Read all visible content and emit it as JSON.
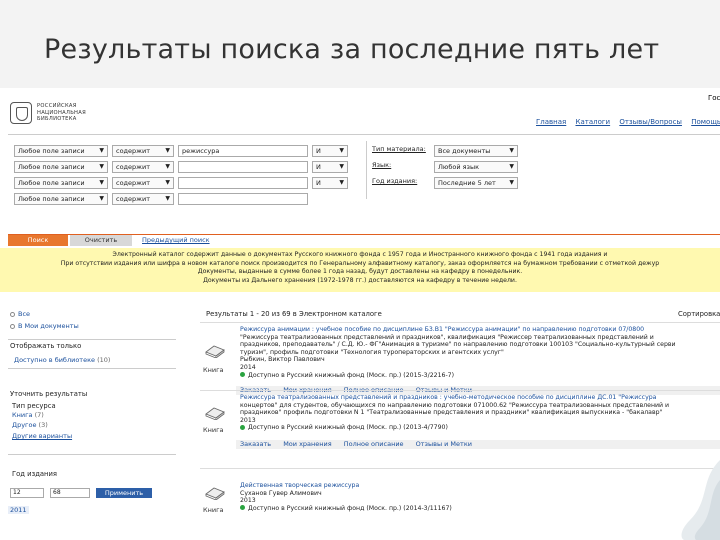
{
  "slide": {
    "title": "Результаты поиска за последние пять лет"
  },
  "site": {
    "logo_lines": [
      "РОССИЙСКАЯ",
      "НАЦИОНАЛЬНАЯ",
      "БИБЛИОТЕКА"
    ],
    "top_edge": "Гос",
    "topnav": [
      "Главная",
      "Каталоги",
      "Отзывы/Вопросы",
      "Помощь"
    ]
  },
  "search": {
    "rows": [
      {
        "field": "Любое поле записи",
        "mode": "содержит",
        "value": "режиссура",
        "op": "И"
      },
      {
        "field": "Любое поле записи",
        "mode": "содержит",
        "value": "",
        "op": "И"
      },
      {
        "field": "Любое поле записи",
        "mode": "содержит",
        "value": "",
        "op": "И"
      },
      {
        "field": "Любое поле записи",
        "mode": "содержит",
        "value": "",
        "op": ""
      }
    ],
    "filters": [
      {
        "label": "Тип материала:",
        "value": "Все документы"
      },
      {
        "label": "Язык:",
        "value": "Любой язык"
      },
      {
        "label": "Год издания:",
        "value": "Последние 5 лет"
      }
    ],
    "buttons": {
      "search": "Поиск",
      "reset": "Очистить",
      "previous": "Предыдущий поиск"
    }
  },
  "notice": {
    "lines": [
      "Электронный каталог содержит данные о документах Русского книжного фонда с 1957 года и Иностранного книжного фонда с 1941 года издания и",
      "При отсутствии издания или шифра в новом каталоге поиск производится по Генеральному алфавитному каталогу, заказ оформляется на бумажном требовании с отметкой дежур",
      "Документы, выданные в сумме более 1 года назад, будут доставлены на кафедру в понедельник.",
      "Документы из Дальнего хранения (1972-1978 гг.) доставляются на кафедру в течение недели."
    ]
  },
  "sidebar": {
    "all": "Все",
    "my_docs": "В Мои документы",
    "show_only": "Отображать только",
    "access_libraries": "Доступно в библиотеке",
    "access_count": "(10)",
    "refine": "Уточнить результаты",
    "resource_type": "Тип ресурса",
    "types": [
      {
        "label": "Книга",
        "count": "(7)"
      },
      {
        "label": "Другое",
        "count": "(3)"
      }
    ],
    "more_variants": "Другие варианты",
    "pub_year": "Год издания",
    "year_from": "12",
    "year_to": "68",
    "apply": "Применить",
    "year_2011": "2011"
  },
  "results": {
    "header": "Результаты 1 - 20 из 69 в Электронном каталоге",
    "sort": "Сортировка",
    "items": [
      {
        "kind": "Книга",
        "lines": [
          "Режиссура анимации : учебное пособие по дисциплине Б3.В1 \"Режиссура анимации\" по направлению подготовки 07/0800",
          "\"Режиссура театрализованных представлений и праздников\", квалификация \"Режиссер театрализованных представлений и",
          "праздников, преподаватель\" / С.Д. Ю.- ФГ\"Анимация в туризме\" по направлению подготовки 100103 \"Социально-культурный серви",
          "туризм\", профиль подготовки \"Технология туроператорских и агентских услуг\"",
          "Рыбкин, Виктор Павлович",
          "2014",
          "Доступно в Русский книжный фонд (Моск. пр.) (2015-3/2216-7)"
        ],
        "actions": [
          "Заказать",
          "Мои хранения",
          "Полное описание",
          "Отзывы и Метки"
        ]
      },
      {
        "kind": "Книга",
        "lines": [
          "Режиссура театрализованных представлений и праздников : учебно-методическое пособие по дисциплине ДС.01 \"Режиссура",
          "концертов\" для студентов, обучающихся по направлению подготовки 071000.62 \"Режиссура театрализованных представлений и",
          "праздников\" профиль подготовки N 1 \"Театрализованные представления и праздники\" квалификация выпускника - \"бакалавр\"",
          "2013",
          "Доступно в Русский книжный фонд (Моск. пр.) (2013-4/7790)"
        ],
        "actions": [
          "Заказать",
          "Мои хранения",
          "Полное описание",
          "Отзывы и Метки"
        ]
      },
      {
        "kind": "Книга",
        "lines": [
          "Действенная творческая режиссура",
          "Суханов Гувер Алимович",
          "2013",
          "Доступно в Русский книжный фонд (Моск. пр.) (2014-3/11167)"
        ],
        "actions": []
      }
    ]
  }
}
